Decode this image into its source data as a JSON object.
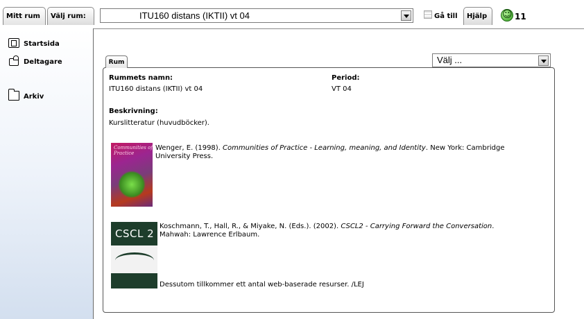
{
  "topbar": {
    "mitt_rum": "Mitt rum",
    "valj_rum": "Välj rum:",
    "room_select_value": "ITU160 distans (IKTII) vt 04",
    "goto": "Gå till",
    "help": "Hjälp",
    "online_count": "11"
  },
  "sidebar": {
    "items": [
      {
        "label": "Startsida",
        "icon": "home-icon"
      },
      {
        "label": "Deltagare",
        "icon": "participants-icon"
      },
      {
        "label": "Arkiv",
        "icon": "folder-icon"
      }
    ]
  },
  "main": {
    "tab": "Rum",
    "select_value": "Välj ...",
    "room_name_label": "Rummets namn:",
    "room_name_value": "ITU160 distans (IKTII) vt 04",
    "period_label": "Period:",
    "period_value": "VT 04",
    "description_label": "Beskrivning:",
    "description_value": "Kurslitteratur (huvudböcker).",
    "books": [
      {
        "cover_title": "Communities of Practice",
        "ref_before": "Wenger, E. (1998). ",
        "ref_italic": "Communities of Practice - Learning, meaning, and Identity",
        "ref_after": ". New York: Cambridge University Press."
      },
      {
        "cover_title": "CSCL 2",
        "ref_before": "Koschmann, T., Hall, R., & Miyake, N. (Eds.). (2002). ",
        "ref_italic": "CSCL2 - Carrying Forward the Conversation",
        "ref_after": ". Mahwah: Lawrence Erlbaum."
      }
    ],
    "footer_note": "Dessutom tillkommer ett antal  web-baserade resurser. /LEJ"
  },
  "colors": {
    "sidebar_gradient_bottom": "#d3dfef",
    "online_green": "#2e9a1a"
  }
}
